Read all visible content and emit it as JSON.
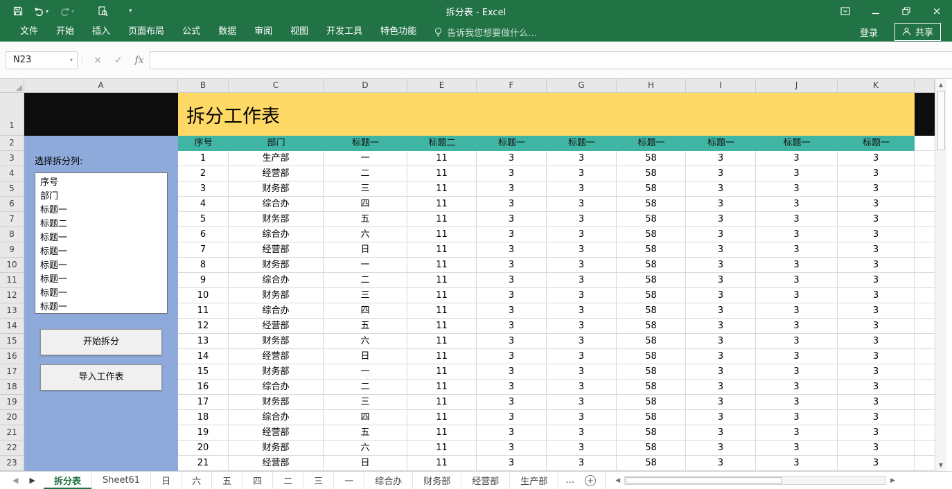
{
  "titlebar": {
    "title": "拆分表 - Excel",
    "signin": "登录",
    "share": "共享",
    "tellme": "告诉我您想要做什么…"
  },
  "ribbon_tabs": [
    "文件",
    "开始",
    "插入",
    "页面布局",
    "公式",
    "数据",
    "审阅",
    "视图",
    "开发工具",
    "特色功能"
  ],
  "formula_bar": {
    "name_box": "N23",
    "fx_label": "fx"
  },
  "panel": {
    "label": "选择拆分列:",
    "list_items": [
      "序号",
      "部门",
      "标题一",
      "标题二",
      "标题一",
      "标题一",
      "标题一",
      "标题一",
      "标题一",
      "标题一"
    ],
    "start_button": "开始拆分",
    "import_button": "导入工作表"
  },
  "sheet": {
    "title": "拆分工作表",
    "column_letters": [
      "A",
      "B",
      "C",
      "D",
      "E",
      "F",
      "G",
      "H",
      "I",
      "J",
      "K"
    ],
    "row_numbers": [
      "1",
      "2",
      "3",
      "4",
      "5",
      "6",
      "7",
      "8",
      "9",
      "10",
      "11",
      "12",
      "13",
      "14",
      "15",
      "16",
      "17",
      "18",
      "19",
      "20",
      "21",
      "22",
      "23"
    ],
    "header_row": [
      "序号",
      "部门",
      "标题一",
      "标题二",
      "标题一",
      "标题一",
      "标题一",
      "标题一",
      "标题一",
      "标题一"
    ],
    "rows": [
      [
        "1",
        "生产部",
        "一",
        "11",
        "3",
        "3",
        "58",
        "3",
        "3",
        "3"
      ],
      [
        "2",
        "经营部",
        "二",
        "11",
        "3",
        "3",
        "58",
        "3",
        "3",
        "3"
      ],
      [
        "3",
        "财务部",
        "三",
        "11",
        "3",
        "3",
        "58",
        "3",
        "3",
        "3"
      ],
      [
        "4",
        "综合办",
        "四",
        "11",
        "3",
        "3",
        "58",
        "3",
        "3",
        "3"
      ],
      [
        "5",
        "财务部",
        "五",
        "11",
        "3",
        "3",
        "58",
        "3",
        "3",
        "3"
      ],
      [
        "6",
        "综合办",
        "六",
        "11",
        "3",
        "3",
        "58",
        "3",
        "3",
        "3"
      ],
      [
        "7",
        "经营部",
        "日",
        "11",
        "3",
        "3",
        "58",
        "3",
        "3",
        "3"
      ],
      [
        "8",
        "财务部",
        "一",
        "11",
        "3",
        "3",
        "58",
        "3",
        "3",
        "3"
      ],
      [
        "9",
        "综合办",
        "二",
        "11",
        "3",
        "3",
        "58",
        "3",
        "3",
        "3"
      ],
      [
        "10",
        "财务部",
        "三",
        "11",
        "3",
        "3",
        "58",
        "3",
        "3",
        "3"
      ],
      [
        "11",
        "综合办",
        "四",
        "11",
        "3",
        "3",
        "58",
        "3",
        "3",
        "3"
      ],
      [
        "12",
        "经营部",
        "五",
        "11",
        "3",
        "3",
        "58",
        "3",
        "3",
        "3"
      ],
      [
        "13",
        "财务部",
        "六",
        "11",
        "3",
        "3",
        "58",
        "3",
        "3",
        "3"
      ],
      [
        "14",
        "经营部",
        "日",
        "11",
        "3",
        "3",
        "58",
        "3",
        "3",
        "3"
      ],
      [
        "15",
        "财务部",
        "一",
        "11",
        "3",
        "3",
        "58",
        "3",
        "3",
        "3"
      ],
      [
        "16",
        "综合办",
        "二",
        "11",
        "3",
        "3",
        "58",
        "3",
        "3",
        "3"
      ],
      [
        "17",
        "财务部",
        "三",
        "11",
        "3",
        "3",
        "58",
        "3",
        "3",
        "3"
      ],
      [
        "18",
        "综合办",
        "四",
        "11",
        "3",
        "3",
        "58",
        "3",
        "3",
        "3"
      ],
      [
        "19",
        "经营部",
        "五",
        "11",
        "3",
        "3",
        "58",
        "3",
        "3",
        "3"
      ],
      [
        "20",
        "财务部",
        "六",
        "11",
        "3",
        "3",
        "58",
        "3",
        "3",
        "3"
      ],
      [
        "21",
        "经营部",
        "日",
        "11",
        "3",
        "3",
        "58",
        "3",
        "3",
        "3"
      ]
    ]
  },
  "sheet_tabs": {
    "tabs": [
      {
        "label": "拆分表",
        "active": true
      },
      {
        "label": "Sheet61"
      },
      {
        "label": "日"
      },
      {
        "label": "六"
      },
      {
        "label": "五"
      },
      {
        "label": "四"
      },
      {
        "label": "二"
      },
      {
        "label": "三"
      },
      {
        "label": "一"
      },
      {
        "label": "综合办"
      },
      {
        "label": "财务部"
      },
      {
        "label": "经营部"
      },
      {
        "label": "生产部"
      }
    ],
    "overflow": "…",
    "new_sheet": "+"
  },
  "colors": {
    "excel_green": "#217346",
    "title_yellow": "#FFD966",
    "header_teal": "#41B5A4",
    "panel_blue": "#8EAADB"
  }
}
